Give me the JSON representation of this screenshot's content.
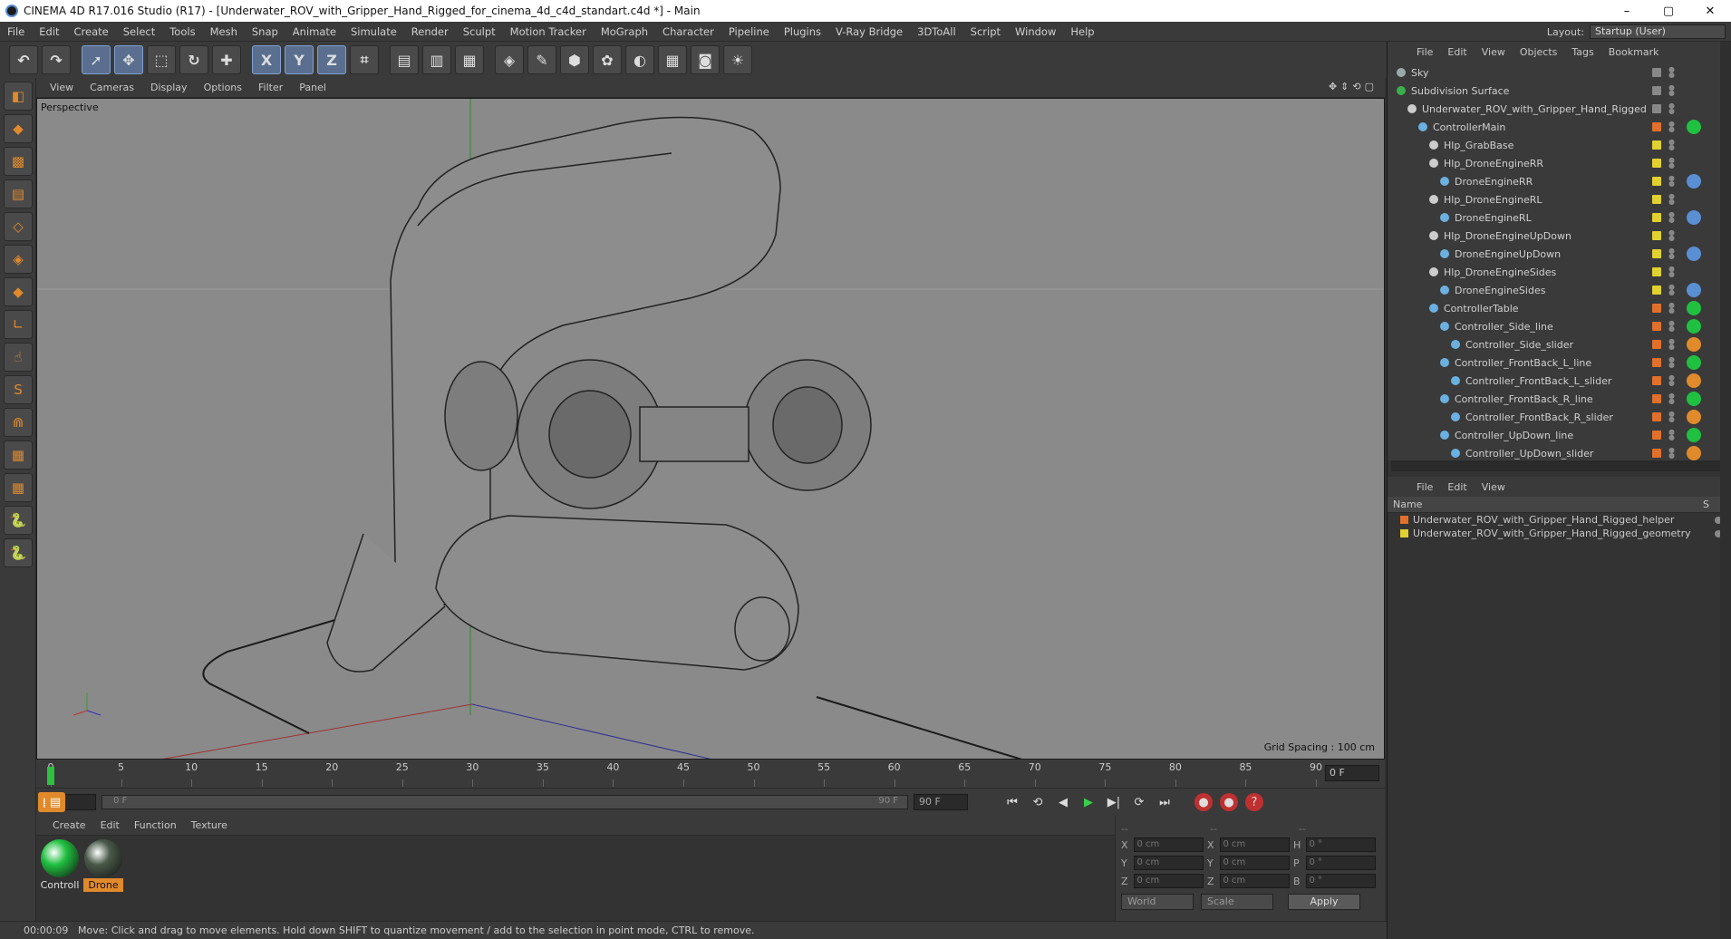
{
  "window": {
    "title": "CINEMA 4D R17.016 Studio (R17) - [Underwater_ROV_with_Gripper_Hand_Rigged_for_cinema_4d_c4d_standart.c4d *] - Main",
    "controls": [
      "–",
      "▢",
      "✕"
    ]
  },
  "menubar": [
    "File",
    "Edit",
    "Create",
    "Select",
    "Tools",
    "Mesh",
    "Snap",
    "Animate",
    "Simulate",
    "Render",
    "Sculpt",
    "Motion Tracker",
    "MoGraph",
    "Character",
    "Pipeline",
    "Plugins",
    "V-Ray Bridge",
    "3DToAll",
    "Script",
    "Window",
    "Help"
  ],
  "layout": {
    "label": "Layout:",
    "value": "Startup (User)"
  },
  "toolbar": {
    "tools": [
      {
        "name": "undo-button",
        "glyph": "↶"
      },
      {
        "name": "redo-button",
        "glyph": "↷"
      },
      {
        "sep": true
      },
      {
        "name": "live-selection-button",
        "glyph": "➚",
        "active": true
      },
      {
        "name": "move-button",
        "glyph": "✥",
        "active": true
      },
      {
        "name": "scale-button",
        "glyph": "⬚"
      },
      {
        "name": "rotate-button",
        "glyph": "↻"
      },
      {
        "name": "recent-tools-button",
        "glyph": "✚"
      },
      {
        "sep": true
      },
      {
        "name": "x-axis-button",
        "glyph": "X",
        "active": true
      },
      {
        "name": "y-axis-button",
        "glyph": "Y",
        "active": true
      },
      {
        "name": "z-axis-button",
        "glyph": "Z",
        "active": true
      },
      {
        "name": "coordinate-system-button",
        "glyph": "⌗"
      },
      {
        "sep": true
      },
      {
        "name": "render-view-button",
        "glyph": "▤"
      },
      {
        "name": "render-picture-viewer-button",
        "glyph": "▥"
      },
      {
        "name": "edit-render-settings-button",
        "glyph": "▦"
      },
      {
        "sep": true
      },
      {
        "name": "cube-button",
        "glyph": "◈"
      },
      {
        "name": "pen-button",
        "glyph": "✎"
      },
      {
        "name": "subdivision-button",
        "glyph": "⬢"
      },
      {
        "name": "cloner-button",
        "glyph": "✿"
      },
      {
        "name": "deformer-button",
        "glyph": "◐"
      },
      {
        "name": "floor-button",
        "glyph": "▦"
      },
      {
        "name": "camera-button",
        "glyph": "◙"
      },
      {
        "name": "light-button",
        "glyph": "☀"
      }
    ]
  },
  "lefttools": [
    {
      "name": "make-editable-icon",
      "glyph": "◧"
    },
    {
      "name": "model-mode-icon",
      "glyph": "◆"
    },
    {
      "name": "texture-mode-icon",
      "glyph": "▩"
    },
    {
      "name": "workplane-mode-icon",
      "glyph": "▤"
    },
    {
      "name": "points-mode-icon",
      "glyph": "◇"
    },
    {
      "name": "edges-mode-icon",
      "glyph": "◈"
    },
    {
      "name": "polygons-mode-icon",
      "glyph": "◆"
    },
    {
      "name": "axis-mode-icon",
      "glyph": "∟"
    },
    {
      "name": "tweak-mode-icon",
      "glyph": "☝"
    },
    {
      "name": "snap-icon",
      "glyph": "S"
    },
    {
      "name": "magnet-icon",
      "glyph": "⋒"
    },
    {
      "name": "workplane-lock-icon",
      "glyph": "▦"
    },
    {
      "name": "grid-snap-icon",
      "glyph": "▦"
    },
    {
      "name": "python-icon",
      "glyph": "🐍"
    },
    {
      "name": "python-2-icon",
      "glyph": "🐍"
    }
  ],
  "viewport": {
    "menu": [
      "View",
      "Cameras",
      "Display",
      "Options",
      "Filter",
      "Panel"
    ],
    "label": "Perspective",
    "grid_spacing": "Grid Spacing : 100 cm"
  },
  "timeline": {
    "ticks": [
      "0",
      "5",
      "10",
      "15",
      "20",
      "25",
      "30",
      "35",
      "40",
      "45",
      "50",
      "55",
      "60",
      "65",
      "70",
      "75",
      "80",
      "85",
      "90"
    ],
    "current": "0 F"
  },
  "transport": {
    "start": "0 F",
    "range_start": "0 F",
    "range_end": "90 F",
    "end": "90 F",
    "buttons": [
      "⏮",
      "⟲",
      "◀",
      "▶",
      "▶|",
      "⟳",
      "⏭"
    ]
  },
  "materials": {
    "menu": [
      "Create",
      "Edit",
      "Function",
      "Texture"
    ],
    "items": [
      {
        "label": "Controll",
        "color": "#20c040",
        "selected": false
      },
      {
        "label": "Drone",
        "color": "#4a5a4a",
        "selected": true
      }
    ]
  },
  "coords": {
    "headers": [
      "--",
      "--",
      "--"
    ],
    "rows": [
      {
        "a": "X",
        "av": "0 cm",
        "b": "X",
        "bv": "0 cm",
        "c": "H",
        "cv": "0 °"
      },
      {
        "a": "Y",
        "av": "0 cm",
        "b": "Y",
        "bv": "0 cm",
        "c": "P",
        "cv": "0 °"
      },
      {
        "a": "Z",
        "av": "0 cm",
        "b": "Z",
        "bv": "0 cm",
        "c": "B",
        "cv": "0 °"
      }
    ],
    "mode1": "World",
    "mode2": "Scale",
    "apply": "Apply"
  },
  "status": {
    "time": "00:00:09",
    "message": "Move: Click and drag to move elements. Hold down SHIFT to quantize movement / add to the selection in point mode, CTRL to remove."
  },
  "objects": {
    "menu": [
      "File",
      "Edit",
      "View",
      "Objects",
      "Tags",
      "Bookmark"
    ],
    "rows": [
      {
        "name": "Sky",
        "indent": 0,
        "icon": "#9aa",
        "sw": "#888",
        "tag": ""
      },
      {
        "name": "Subdivision Surface",
        "indent": 0,
        "icon": "#3ab04a",
        "sw": "#888",
        "tag": ""
      },
      {
        "name": "Underwater_ROV_with_Gripper_Hand_Rigged",
        "indent": 1,
        "icon": "#ccc",
        "sw": "#888",
        "tag": ""
      },
      {
        "name": "ControllerMain",
        "indent": 2,
        "icon": "#6ab0e0",
        "sw": "#e0702c",
        "tag": "#20c040"
      },
      {
        "name": "Hlp_GrabBase",
        "indent": 3,
        "icon": "#ccc",
        "sw": "#e0d030",
        "tag": ""
      },
      {
        "name": "Hlp_DroneEngineRR",
        "indent": 3,
        "icon": "#ccc",
        "sw": "#e0d030",
        "tag": ""
      },
      {
        "name": "DroneEngineRR",
        "indent": 4,
        "icon": "#6ab0e0",
        "sw": "#e0d030",
        "tag": "#5a8fd4"
      },
      {
        "name": "Hlp_DroneEngineRL",
        "indent": 3,
        "icon": "#ccc",
        "sw": "#e0d030",
        "tag": ""
      },
      {
        "name": "DroneEngineRL",
        "indent": 4,
        "icon": "#6ab0e0",
        "sw": "#e0d030",
        "tag": "#5a8fd4"
      },
      {
        "name": "Hlp_DroneEngineUpDown",
        "indent": 3,
        "icon": "#ccc",
        "sw": "#e0d030",
        "tag": ""
      },
      {
        "name": "DroneEngineUpDown",
        "indent": 4,
        "icon": "#6ab0e0",
        "sw": "#e0d030",
        "tag": "#5a8fd4"
      },
      {
        "name": "Hlp_DroneEngineSides",
        "indent": 3,
        "icon": "#ccc",
        "sw": "#e0d030",
        "tag": ""
      },
      {
        "name": "DroneEngineSides",
        "indent": 4,
        "icon": "#6ab0e0",
        "sw": "#e0d030",
        "tag": "#5a8fd4"
      },
      {
        "name": "ControllerTable",
        "indent": 3,
        "icon": "#6ab0e0",
        "sw": "#e0702c",
        "tag": "#20c040"
      },
      {
        "name": "Controller_Side_line",
        "indent": 4,
        "icon": "#6ab0e0",
        "sw": "#e0702c",
        "tag": "#20c040"
      },
      {
        "name": "Controller_Side_slider",
        "indent": 5,
        "icon": "#6ab0e0",
        "sw": "#e0702c",
        "tag": "#e08a2c"
      },
      {
        "name": "Controller_FrontBack_L_line",
        "indent": 4,
        "icon": "#6ab0e0",
        "sw": "#e0702c",
        "tag": "#20c040"
      },
      {
        "name": "Controller_FrontBack_L_slider",
        "indent": 5,
        "icon": "#6ab0e0",
        "sw": "#e0702c",
        "tag": "#e08a2c"
      },
      {
        "name": "Controller_FrontBack_R_line",
        "indent": 4,
        "icon": "#6ab0e0",
        "sw": "#e0702c",
        "tag": "#20c040"
      },
      {
        "name": "Controller_FrontBack_R_slider",
        "indent": 5,
        "icon": "#6ab0e0",
        "sw": "#e0702c",
        "tag": "#e08a2c"
      },
      {
        "name": "Controller_UpDown_line",
        "indent": 4,
        "icon": "#6ab0e0",
        "sw": "#e0702c",
        "tag": "#20c040"
      },
      {
        "name": "Controller_UpDown_slider",
        "indent": 5,
        "icon": "#6ab0e0",
        "sw": "#e0702c",
        "tag": "#e08a2c"
      }
    ]
  },
  "layers": {
    "menu": [
      "File",
      "Edit",
      "View"
    ],
    "header": "Name",
    "header_right": "S",
    "rows": [
      {
        "name": "Underwater_ROV_with_Gripper_Hand_Rigged_helper",
        "color": "#e0702c"
      },
      {
        "name": "Underwater_ROV_with_Gripper_Hand_Rigged_geometry",
        "color": "#e0d030"
      }
    ]
  }
}
